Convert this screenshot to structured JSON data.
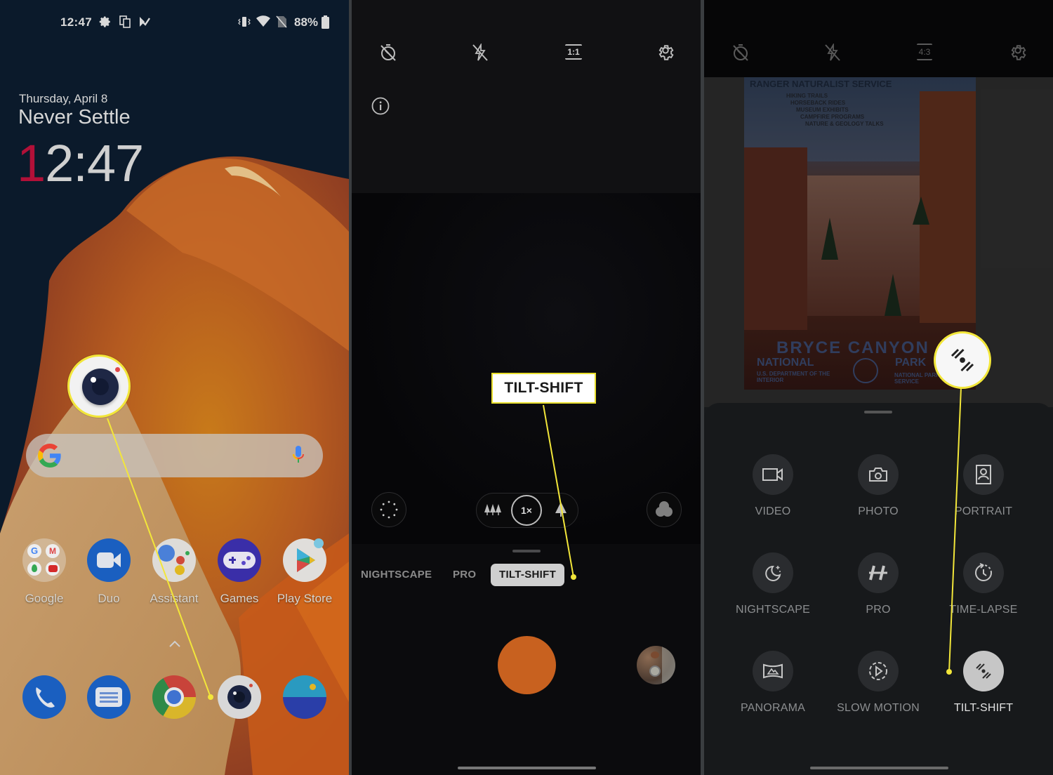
{
  "panel1": {
    "status_bar": {
      "time": "12:47",
      "left_icons": [
        "settings-gear-icon",
        "screen-mirror-icon",
        "download-check-icon"
      ],
      "right_icons": [
        "vibrate-icon",
        "wifi-icon",
        "no-sim-icon"
      ],
      "battery": "88%"
    },
    "lock_widget": {
      "date": "Thursday, April 8",
      "motto": "Never Settle",
      "clock_first_digit": "1",
      "clock_rest": "2:47"
    },
    "search_bar": {
      "left_icon": "google-g-icon",
      "right_icon": "mic-icon"
    },
    "app_row": [
      {
        "label": "Google",
        "icon": "google-folder-icon"
      },
      {
        "label": "Duo",
        "icon": "duo-video-icon"
      },
      {
        "label": "Assistant",
        "icon": "assistant-icon"
      },
      {
        "label": "Games",
        "icon": "games-controller-icon"
      },
      {
        "label": "Play Store",
        "icon": "play-store-icon"
      }
    ],
    "app_drawer_arrow": "^",
    "dock": [
      {
        "name": "Phone",
        "icon": "phone-icon"
      },
      {
        "name": "Messages",
        "icon": "messages-icon"
      },
      {
        "name": "Chrome",
        "icon": "chrome-icon"
      },
      {
        "name": "Camera",
        "icon": "camera-app-icon"
      },
      {
        "name": "Gallery",
        "icon": "gallery-icon"
      }
    ],
    "callout": {
      "target": "Camera",
      "icon": "camera-app-icon"
    }
  },
  "panel2": {
    "top_icons": [
      "timer-off-icon",
      "flash-off-icon",
      "aspect-ratio-icon",
      "settings-icon"
    ],
    "aspect_ratio": "1:1",
    "info_icon": "info-icon",
    "zoom": {
      "wide_icon": "trees-wide-icon",
      "level": "1×",
      "tele_icon": "tree-tele-icon"
    },
    "left_round_icon": "dotted-circle-icon",
    "right_round_icon": "filters-icon",
    "modes": [
      "NIGHTSCAPE",
      "PRO",
      "TILT-SHIFT"
    ],
    "active_mode": "TILT-SHIFT",
    "callout_label": "TILT-SHIFT",
    "shutter_color": "#c8611f"
  },
  "panel3": {
    "top_icons": [
      "timer-off-icon",
      "flash-off-icon",
      "aspect-ratio-icon",
      "settings-icon"
    ],
    "aspect_ratio": "4:3",
    "poster": {
      "header": "RANGER NATURALIST SERVICE",
      "activities": [
        "HIKING TRAILS",
        "HORSEBACK RIDES",
        "MUSEUM EXHIBITS",
        "CAMPFIRE PROGRAMS",
        "NATURE & GEOLOGY TALKS"
      ],
      "title_line1": "BRYCE CANYON",
      "title_line2_left": "NATIONAL",
      "title_line2_right": "PARK",
      "footer_left": "U.S. DEPARTMENT OF THE INTERIOR",
      "footer_right": "NATIONAL PARK SERVICE"
    },
    "modes": [
      {
        "label": "VIDEO",
        "icon": "video-camera-icon"
      },
      {
        "label": "PHOTO",
        "icon": "photo-camera-icon"
      },
      {
        "label": "PORTRAIT",
        "icon": "portrait-icon"
      },
      {
        "label": "NIGHTSCAPE",
        "icon": "moon-stars-icon"
      },
      {
        "label": "PRO",
        "icon": "pro-h-icon"
      },
      {
        "label": "TIME-LAPSE",
        "icon": "time-lapse-icon"
      },
      {
        "label": "PANORAMA",
        "icon": "panorama-icon"
      },
      {
        "label": "SLOW MOTION",
        "icon": "slow-motion-icon"
      },
      {
        "label": "TILT-SHIFT",
        "icon": "tilt-shift-icon"
      }
    ],
    "active_mode": "TILT-SHIFT",
    "callout_icon": "tilt-shift-icon"
  },
  "colors": {
    "callout_yellow": "#f2e63a",
    "lock_accent_red": "#b21038",
    "shutter_orange": "#c8611f"
  }
}
